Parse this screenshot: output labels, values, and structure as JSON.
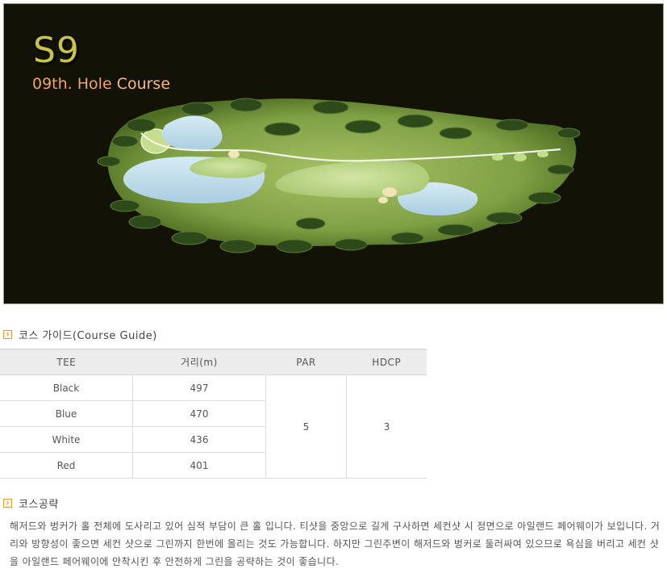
{
  "course": {
    "hole_code": "S9",
    "hole_number_text": "09th. Hole",
    "hole_course_text": "Course"
  },
  "guide": {
    "heading": "코스 가이드(Course Guide)",
    "columns": [
      "TEE",
      "거리(m)",
      "PAR",
      "HDCP"
    ],
    "rows": [
      {
        "tee": "Black",
        "distance": "497"
      },
      {
        "tee": "Blue",
        "distance": "470"
      },
      {
        "tee": "White",
        "distance": "436"
      },
      {
        "tee": "Red",
        "distance": "401"
      }
    ],
    "par": "5",
    "hdcp": "3"
  },
  "strategy": {
    "heading": "코스공략",
    "text": "해저드와 벙커가 홀 전체에 도사리고 있어 심적 부담이 큰 홀 입니다. 티샷을 중앙으로 길게 구사하면 세컨샷 시 정면으로 아일랜드 페어웨이가 보입니다. 거리와 방향성이 좋으면 세컨 샷으로 그린까지 한번에 올리는 것도 가능합니다. 하지만 그린주변이 해저드와 벙커로 둘러싸여 있으므로 욕심을 버리고 세컨 샷을 아일랜드 페어웨이에 안착시킨 후 안전하게 그린을 공략하는 것이 좋습니다."
  },
  "colors": {
    "background_dark": "#121206",
    "fairway": "#8fb04a",
    "water": "#bcd8e6",
    "accent_orange": "#e07a10"
  }
}
